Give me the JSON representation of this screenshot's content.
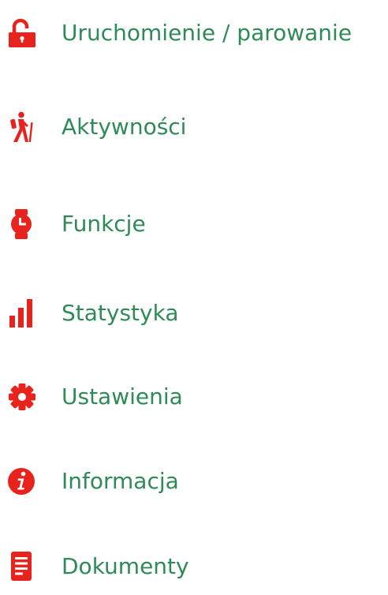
{
  "colors": {
    "icon": "#e8231d",
    "label": "#2e8b57"
  },
  "menu": {
    "items": [
      {
        "label": "Uruchomienie / parowanie",
        "icon": "unlock-icon"
      },
      {
        "label": "Aktywności",
        "icon": "hiker-icon"
      },
      {
        "label": "Funkcje",
        "icon": "watch-icon"
      },
      {
        "label": "Statystyka",
        "icon": "bar-chart-icon"
      },
      {
        "label": "Ustawienia",
        "icon": "gear-icon"
      },
      {
        "label": "Informacja",
        "icon": "info-icon"
      },
      {
        "label": "Dokumenty",
        "icon": "document-icon"
      }
    ]
  }
}
